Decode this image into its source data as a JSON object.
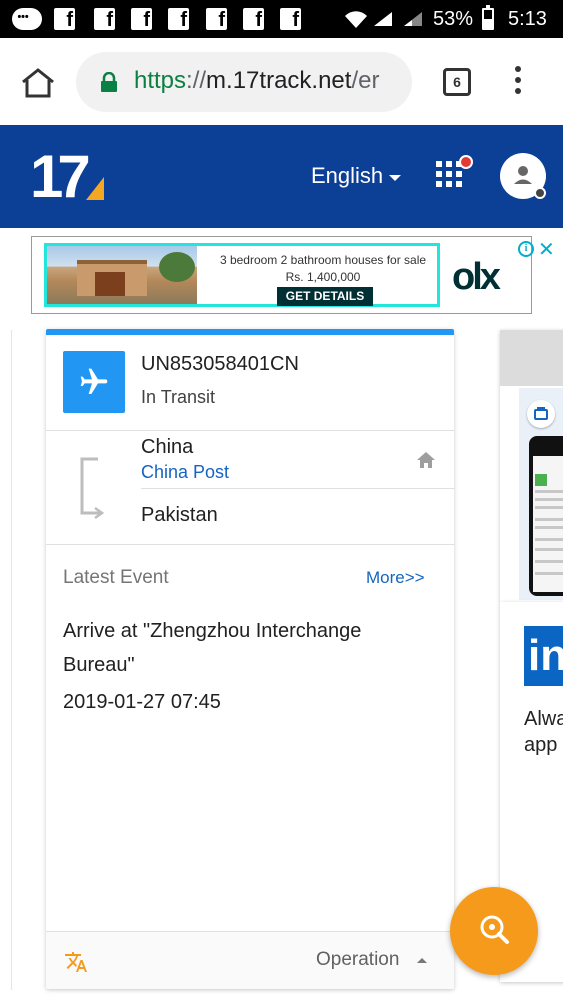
{
  "status_bar": {
    "battery_percent": "53%",
    "time": "5:13",
    "icons": [
      "messages-icon",
      "facebook-icon",
      "wifi-icon",
      "signal-icon",
      "battery-icon"
    ]
  },
  "browser": {
    "url_scheme": "https",
    "url_separator": "://",
    "url_host": "m.17track.net",
    "url_rest": "/er",
    "tab_count": "6"
  },
  "site_header": {
    "logo_text": "17",
    "language": "English",
    "colors": {
      "header_bg": "#0c3f96",
      "accent": "#2196f3",
      "logo_orange": "#f5a623"
    }
  },
  "ad": {
    "headline": "3 bedroom 2 bathroom houses for sale",
    "price": "Rs. 1,400,000",
    "cta": "GET DETAILS",
    "brand": "olx"
  },
  "card": {
    "tracking_number": "UN853058401CN",
    "status": "In Transit",
    "origin_country": "China",
    "carrier": "China Post",
    "destination_country": "Pakistan",
    "latest_event_label": "Latest Event",
    "more_link": "More>>",
    "event_description": "Arrive at \"Zhengzhou Interchange Bureau\"",
    "event_time": "2019-01-27 07:45",
    "footer_operation": "Operation"
  },
  "right_card": {
    "text_partial": "Alwa app"
  }
}
